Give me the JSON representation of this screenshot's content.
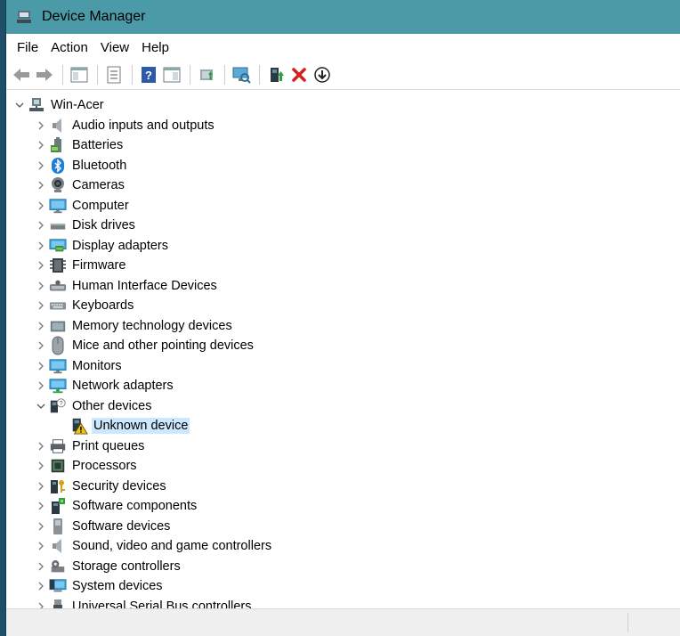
{
  "window": {
    "title": "Device Manager"
  },
  "menu": [
    "File",
    "Action",
    "View",
    "Help"
  ],
  "toolbar": [
    "back-icon",
    "forward-icon",
    "sep",
    "show-hide-console-tree-icon",
    "sep",
    "properties-icon",
    "sep",
    "help-icon",
    "action-pane-icon",
    "sep",
    "update-driver-icon",
    "sep",
    "scan-hardware-icon",
    "sep",
    "enable-device-icon",
    "uninstall-icon",
    "download-icon"
  ],
  "tree": {
    "root": {
      "label": "Win-Acer",
      "icon": "computer-tree-icon",
      "expanded": true
    },
    "categories": [
      {
        "label": "Audio inputs and outputs",
        "icon": "speaker-icon"
      },
      {
        "label": "Batteries",
        "icon": "battery-icon"
      },
      {
        "label": "Bluetooth",
        "icon": "bluetooth-icon"
      },
      {
        "label": "Cameras",
        "icon": "camera-icon"
      },
      {
        "label": "Computer",
        "icon": "monitor-icon"
      },
      {
        "label": "Disk drives",
        "icon": "disk-icon"
      },
      {
        "label": "Display adapters",
        "icon": "display-adapter-icon"
      },
      {
        "label": "Firmware",
        "icon": "firmware-icon"
      },
      {
        "label": "Human Interface Devices",
        "icon": "hid-icon"
      },
      {
        "label": "Keyboards",
        "icon": "keyboard-icon"
      },
      {
        "label": "Memory technology devices",
        "icon": "memory-icon"
      },
      {
        "label": "Mice and other pointing devices",
        "icon": "mouse-icon"
      },
      {
        "label": "Monitors",
        "icon": "monitor-icon"
      },
      {
        "label": "Network adapters",
        "icon": "network-icon"
      },
      {
        "label": "Other devices",
        "icon": "other-devices-icon",
        "expanded": true,
        "children": [
          {
            "label": "Unknown device",
            "icon": "warning-device-icon",
            "selected": true
          }
        ]
      },
      {
        "label": "Print queues",
        "icon": "printer-icon"
      },
      {
        "label": "Processors",
        "icon": "processor-icon"
      },
      {
        "label": "Security devices",
        "icon": "security-icon"
      },
      {
        "label": "Software components",
        "icon": "software-component-icon"
      },
      {
        "label": "Software devices",
        "icon": "software-device-icon"
      },
      {
        "label": "Sound, video and game controllers",
        "icon": "speaker-icon"
      },
      {
        "label": "Storage controllers",
        "icon": "storage-icon"
      },
      {
        "label": "System devices",
        "icon": "system-icon"
      },
      {
        "label": "Universal Serial Bus controllers",
        "icon": "usb-icon"
      }
    ]
  },
  "colors": {
    "titlebar": "#4a9aa8",
    "selection": "#cce8ff"
  }
}
